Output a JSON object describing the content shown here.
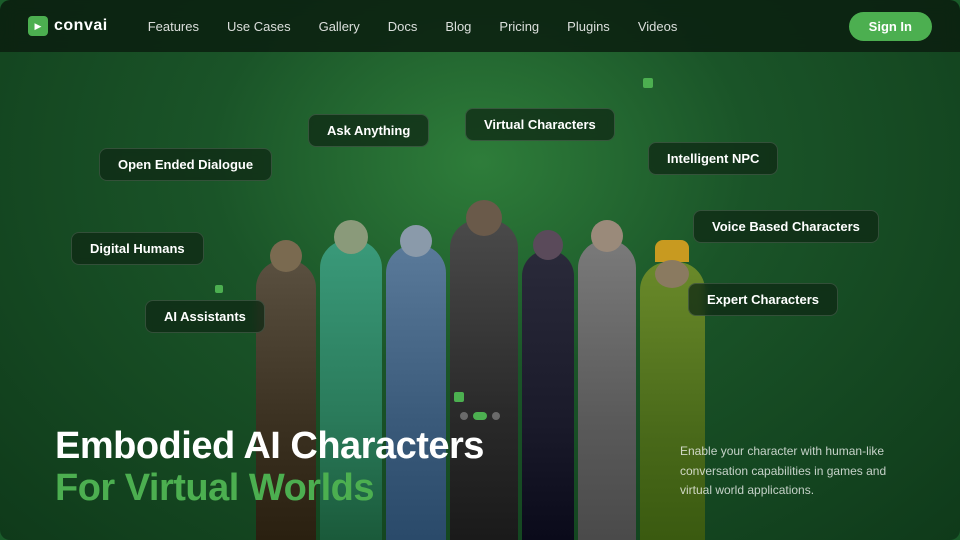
{
  "brand": {
    "name": "convai",
    "logo_icon": "play-icon"
  },
  "nav": {
    "links": [
      {
        "label": "Features",
        "id": "features"
      },
      {
        "label": "Use Cases",
        "id": "use-cases"
      },
      {
        "label": "Gallery",
        "id": "gallery"
      },
      {
        "label": "Docs",
        "id": "docs"
      },
      {
        "label": "Blog",
        "id": "blog"
      },
      {
        "label": "Pricing",
        "id": "pricing"
      },
      {
        "label": "Plugins",
        "id": "plugins"
      },
      {
        "label": "Videos",
        "id": "videos"
      }
    ],
    "cta": "Sign In"
  },
  "chips": [
    {
      "id": "virtual-characters",
      "label": "Virtual Characters"
    },
    {
      "id": "ask-anything",
      "label": "Ask Anything"
    },
    {
      "id": "intelligent-npc",
      "label": "Intelligent NPC"
    },
    {
      "id": "open-ended-dialogue",
      "label": "Open Ended Dialogue"
    },
    {
      "id": "digital-humans",
      "label": "Digital Humans"
    },
    {
      "id": "voice-based",
      "label": "Voice Based Characters"
    },
    {
      "id": "expert-characters",
      "label": "Expert Characters"
    },
    {
      "id": "ai-assistants",
      "label": "AI Assistants"
    }
  ],
  "hero": {
    "title_line1": "Embodied AI Characters",
    "title_line2": "For Virtual Worlds",
    "description": "Enable your character with human-like conversation capabilities in games and virtual world applications."
  },
  "colors": {
    "accent": "#4caf50",
    "bg_dark": "#0f3a1a",
    "bg_mid": "#1a5428",
    "text_white": "#ffffff",
    "text_muted": "rgba(255,255,255,0.75)"
  }
}
